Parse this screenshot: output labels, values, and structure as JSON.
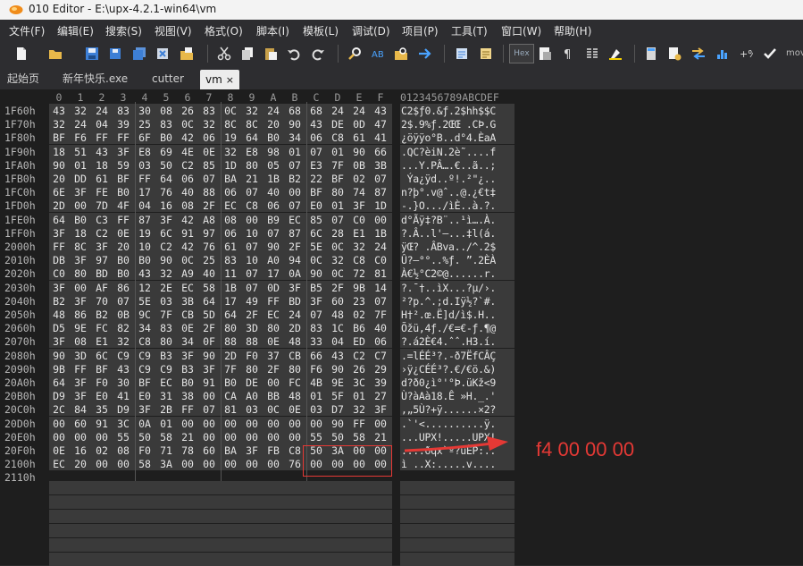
{
  "window": {
    "title": "010 Editor - E:\\upx-4.2.1-win64\\vm"
  },
  "menu": [
    "文件(F)",
    "编辑(E)",
    "搜索(S)",
    "视图(V)",
    "格式(O)",
    "脚本(I)",
    "模板(L)",
    "调试(D)",
    "项目(P)",
    "工具(T)",
    "窗口(W)",
    "帮助(H)"
  ],
  "toolbar": {
    "hex_label": "Hex",
    "more_label": "mov",
    "icons": [
      "new-file-icon",
      "open-folder-icon",
      "save-icon",
      "save-as-icon",
      "save-all-icon",
      "close-file-icon",
      "workspace-icon",
      "cut-icon",
      "copy-icon",
      "paste-icon",
      "undo-icon",
      "redo-icon",
      "find-icon",
      "replace-icon",
      "find-in-files-icon",
      "goto-icon",
      "script-icon",
      "template-icon",
      "hex-icon",
      "pilcrow-icon",
      "columns-icon",
      "highlight-icon",
      "calculator-icon",
      "file-info-icon",
      "compare-icon",
      "histogram-icon",
      "checksum-icon",
      "check-icon"
    ],
    "accent": "#4aa3ff"
  },
  "tabs": [
    {
      "label": "起始页",
      "active": false
    },
    {
      "label": "新年快乐.exe",
      "active": false
    },
    {
      "label": "cutter",
      "active": false
    },
    {
      "label": "vm",
      "active": true,
      "close": "×"
    }
  ],
  "editor": {
    "header_digits": [
      "0",
      "1",
      "2",
      "3",
      "4",
      "5",
      "6",
      "7",
      "8",
      "9",
      "A",
      "B",
      "C",
      "D",
      "E",
      "F"
    ],
    "ascii_header": "0123456789ABCDEF",
    "rows": [
      {
        "addr": "1F60h",
        "bytes": [
          "43",
          "32",
          "24",
          "83",
          "30",
          "08",
          "26",
          "83",
          "0C",
          "32",
          "24",
          "68",
          "68",
          "24",
          "24",
          "43"
        ],
        "ascii": "C2$ƒ0.&ƒ.2$hh$$C"
      },
      {
        "addr": "1F70h",
        "bytes": [
          "32",
          "24",
          "04",
          "39",
          "25",
          "83",
          "0C",
          "32",
          "8C",
          "8C",
          "20",
          "90",
          "43",
          "DE",
          "0D",
          "47"
        ],
        "ascii": "2$.9%ƒ.2ŒŒ .CÞ.G"
      },
      {
        "addr": "1F80h",
        "bytes": [
          "BF",
          "F6",
          "FF",
          "FF",
          "6F",
          "B0",
          "42",
          "06",
          "19",
          "64",
          "B0",
          "34",
          "06",
          "C8",
          "61",
          "41"
        ],
        "ascii": "¿öÿÿo°B..d°4.ÈaA"
      },
      {
        "addr": "1F90h",
        "bytes": [
          "18",
          "51",
          "43",
          "3F",
          "E8",
          "69",
          "4E",
          "0E",
          "32",
          "E8",
          "98",
          "01",
          "07",
          "01",
          "90",
          "66"
        ],
        "ascii": ".QC?èiN.2è˜....f"
      },
      {
        "addr": "1FA0h",
        "bytes": [
          "90",
          "01",
          "18",
          "59",
          "03",
          "50",
          "C2",
          "85",
          "1D",
          "80",
          "05",
          "07",
          "E3",
          "7F",
          "0B",
          "3B"
        ],
        "ascii": "...Y.PÂ….€..ã..;"
      },
      {
        "addr": "1FB0h",
        "bytes": [
          "20",
          "DD",
          "61",
          "BF",
          "FF",
          "64",
          "06",
          "07",
          "BA",
          "21",
          "1B",
          "B2",
          "22",
          "BF",
          "02",
          "07"
        ],
        "ascii": " Ýa¿ÿd..º!.²\"¿.."
      },
      {
        "addr": "1FC0h",
        "bytes": [
          "6E",
          "3F",
          "FE",
          "B0",
          "17",
          "76",
          "40",
          "88",
          "06",
          "07",
          "40",
          "00",
          "BF",
          "80",
          "74",
          "87"
        ],
        "ascii": "n?þ°.v@ˆ..@.¿€t‡"
      },
      {
        "addr": "1FD0h",
        "bytes": [
          "2D",
          "00",
          "7D",
          "4F",
          "04",
          "16",
          "08",
          "2F",
          "EC",
          "C8",
          "06",
          "07",
          "E0",
          "01",
          "3F",
          "1D"
        ],
        "ascii": "-.}O.../ìÈ..à.?."
      },
      {
        "addr": "1FE0h",
        "bytes": [
          "64",
          "B0",
          "C3",
          "FF",
          "87",
          "3F",
          "42",
          "A8",
          "08",
          "00",
          "B9",
          "EC",
          "85",
          "07",
          "C0",
          "00"
        ],
        "ascii": "d°Ãÿ‡?B¨..¹ì….À."
      },
      {
        "addr": "1FF0h",
        "bytes": [
          "3F",
          "18",
          "C2",
          "0E",
          "19",
          "6C",
          "91",
          "97",
          "06",
          "10",
          "07",
          "87",
          "6C",
          "28",
          "E1",
          "1B"
        ],
        "ascii": "?.Â..l'—...‡l(á."
      },
      {
        "addr": "2000h",
        "bytes": [
          "FF",
          "8C",
          "3F",
          "20",
          "10",
          "C2",
          "42",
          "76",
          "61",
          "07",
          "90",
          "2F",
          "5E",
          "0C",
          "32",
          "24"
        ],
        "ascii": "ÿŒ? .ÂBva../^.2$"
      },
      {
        "addr": "2010h",
        "bytes": [
          "DB",
          "3F",
          "97",
          "B0",
          "B0",
          "90",
          "0C",
          "25",
          "83",
          "10",
          "A0",
          "94",
          "0C",
          "32",
          "C8",
          "C0"
        ],
        "ascii": "Û?—°°..%ƒ. ”.2ÈÀ"
      },
      {
        "addr": "2020h",
        "bytes": [
          "C0",
          "80",
          "BD",
          "B0",
          "43",
          "32",
          "A9",
          "40",
          "11",
          "07",
          "17",
          "0A",
          "90",
          "0C",
          "72",
          "81"
        ],
        "ascii": "À€½°C2©@......r."
      },
      {
        "addr": "2030h",
        "bytes": [
          "3F",
          "00",
          "AF",
          "86",
          "12",
          "2E",
          "EC",
          "58",
          "1B",
          "07",
          "0D",
          "3F",
          "B5",
          "2F",
          "9B",
          "14"
        ],
        "ascii": "?.¯†..ìX...?µ/›."
      },
      {
        "addr": "2040h",
        "bytes": [
          "B2",
          "3F",
          "70",
          "07",
          "5E",
          "03",
          "3B",
          "64",
          "17",
          "49",
          "FF",
          "BD",
          "3F",
          "60",
          "23",
          "07"
        ],
        "ascii": "²?p.^.;d.Iÿ½?`#."
      },
      {
        "addr": "2050h",
        "bytes": [
          "48",
          "86",
          "B2",
          "0B",
          "9C",
          "7F",
          "CB",
          "5D",
          "64",
          "2F",
          "EC",
          "24",
          "07",
          "48",
          "02",
          "7F"
        ],
        "ascii": "H†².œ.Ë]d/ì$.H.."
      },
      {
        "addr": "2060h",
        "bytes": [
          "D5",
          "9E",
          "FC",
          "82",
          "34",
          "83",
          "0E",
          "2F",
          "80",
          "3D",
          "80",
          "2D",
          "83",
          "1C",
          "B6",
          "40"
        ],
        "ascii": "Õžü‚4ƒ./€=€-ƒ.¶@"
      },
      {
        "addr": "2070h",
        "bytes": [
          "3F",
          "08",
          "E1",
          "32",
          "C8",
          "80",
          "34",
          "0F",
          "88",
          "88",
          "0E",
          "48",
          "33",
          "04",
          "ED",
          "06"
        ],
        "ascii": "?.á2È€4.ˆˆ.H3.í."
      },
      {
        "addr": "2080h",
        "bytes": [
          "90",
          "3D",
          "6C",
          "C9",
          "C9",
          "B3",
          "3F",
          "90",
          "2D",
          "F0",
          "37",
          "CB",
          "66",
          "43",
          "C2",
          "C7"
        ],
        "ascii": ".=lÉÉ³?.-ð7ËfCÂÇ"
      },
      {
        "addr": "2090h",
        "bytes": [
          "9B",
          "FF",
          "BF",
          "43",
          "C9",
          "C9",
          "B3",
          "3F",
          "7F",
          "80",
          "2F",
          "80",
          "F6",
          "90",
          "26",
          "29"
        ],
        "ascii": "›ÿ¿CÉÉ³?.€/€ö.&)"
      },
      {
        "addr": "20A0h",
        "bytes": [
          "64",
          "3F",
          "F0",
          "30",
          "BF",
          "EC",
          "B0",
          "91",
          "B0",
          "DE",
          "00",
          "FC",
          "4B",
          "9E",
          "3C",
          "39"
        ],
        "ascii": "d?ð0¿ì°'°Þ.üKž<9"
      },
      {
        "addr": "20B0h",
        "bytes": [
          "D9",
          "3F",
          "E0",
          "41",
          "E0",
          "31",
          "38",
          "00",
          "CA",
          "A0",
          "BB",
          "48",
          "01",
          "5F",
          "01",
          "27"
        ],
        "ascii": "Ù?àAà18.Ê »H._.'"
      },
      {
        "addr": "20C0h",
        "bytes": [
          "2C",
          "84",
          "35",
          "D9",
          "3F",
          "2B",
          "FF",
          "07",
          "81",
          "03",
          "0C",
          "0E",
          "03",
          "D7",
          "32",
          "3F"
        ],
        "ascii": ",„5Ù?+ÿ......×2?"
      },
      {
        "addr": "20D0h",
        "bytes": [
          "00",
          "60",
          "91",
          "3C",
          "0A",
          "01",
          "00",
          "00",
          "00",
          "00",
          "00",
          "00",
          "00",
          "90",
          "FF",
          "00"
        ],
        "ascii": ".`'<..........ÿ."
      },
      {
        "addr": "20E0h",
        "bytes": [
          "00",
          "00",
          "00",
          "55",
          "50",
          "58",
          "21",
          "00",
          "00",
          "00",
          "00",
          "00",
          "55",
          "50",
          "58",
          "21"
        ],
        "ascii": "...UPX!.....UPX!"
      },
      {
        "addr": "20F0h",
        "bytes": [
          "0E",
          "16",
          "02",
          "08",
          "F0",
          "71",
          "78",
          "60",
          "BA",
          "3F",
          "FB",
          "C8",
          "50",
          "3A",
          "00",
          "00"
        ],
        "ascii": "....ðqx`º?ûÈP:.."
      },
      {
        "addr": "2100h",
        "bytes": [
          "EC",
          "20",
          "00",
          "00",
          "58",
          "3A",
          "00",
          "00",
          "00",
          "00",
          "00",
          "76",
          "00",
          "00",
          "00",
          "00"
        ],
        "ascii": "ì ..X:.....v...."
      }
    ],
    "last_addr": "2110h"
  },
  "annotation": {
    "text": "f4 00 00 00",
    "color": "#e53935"
  }
}
